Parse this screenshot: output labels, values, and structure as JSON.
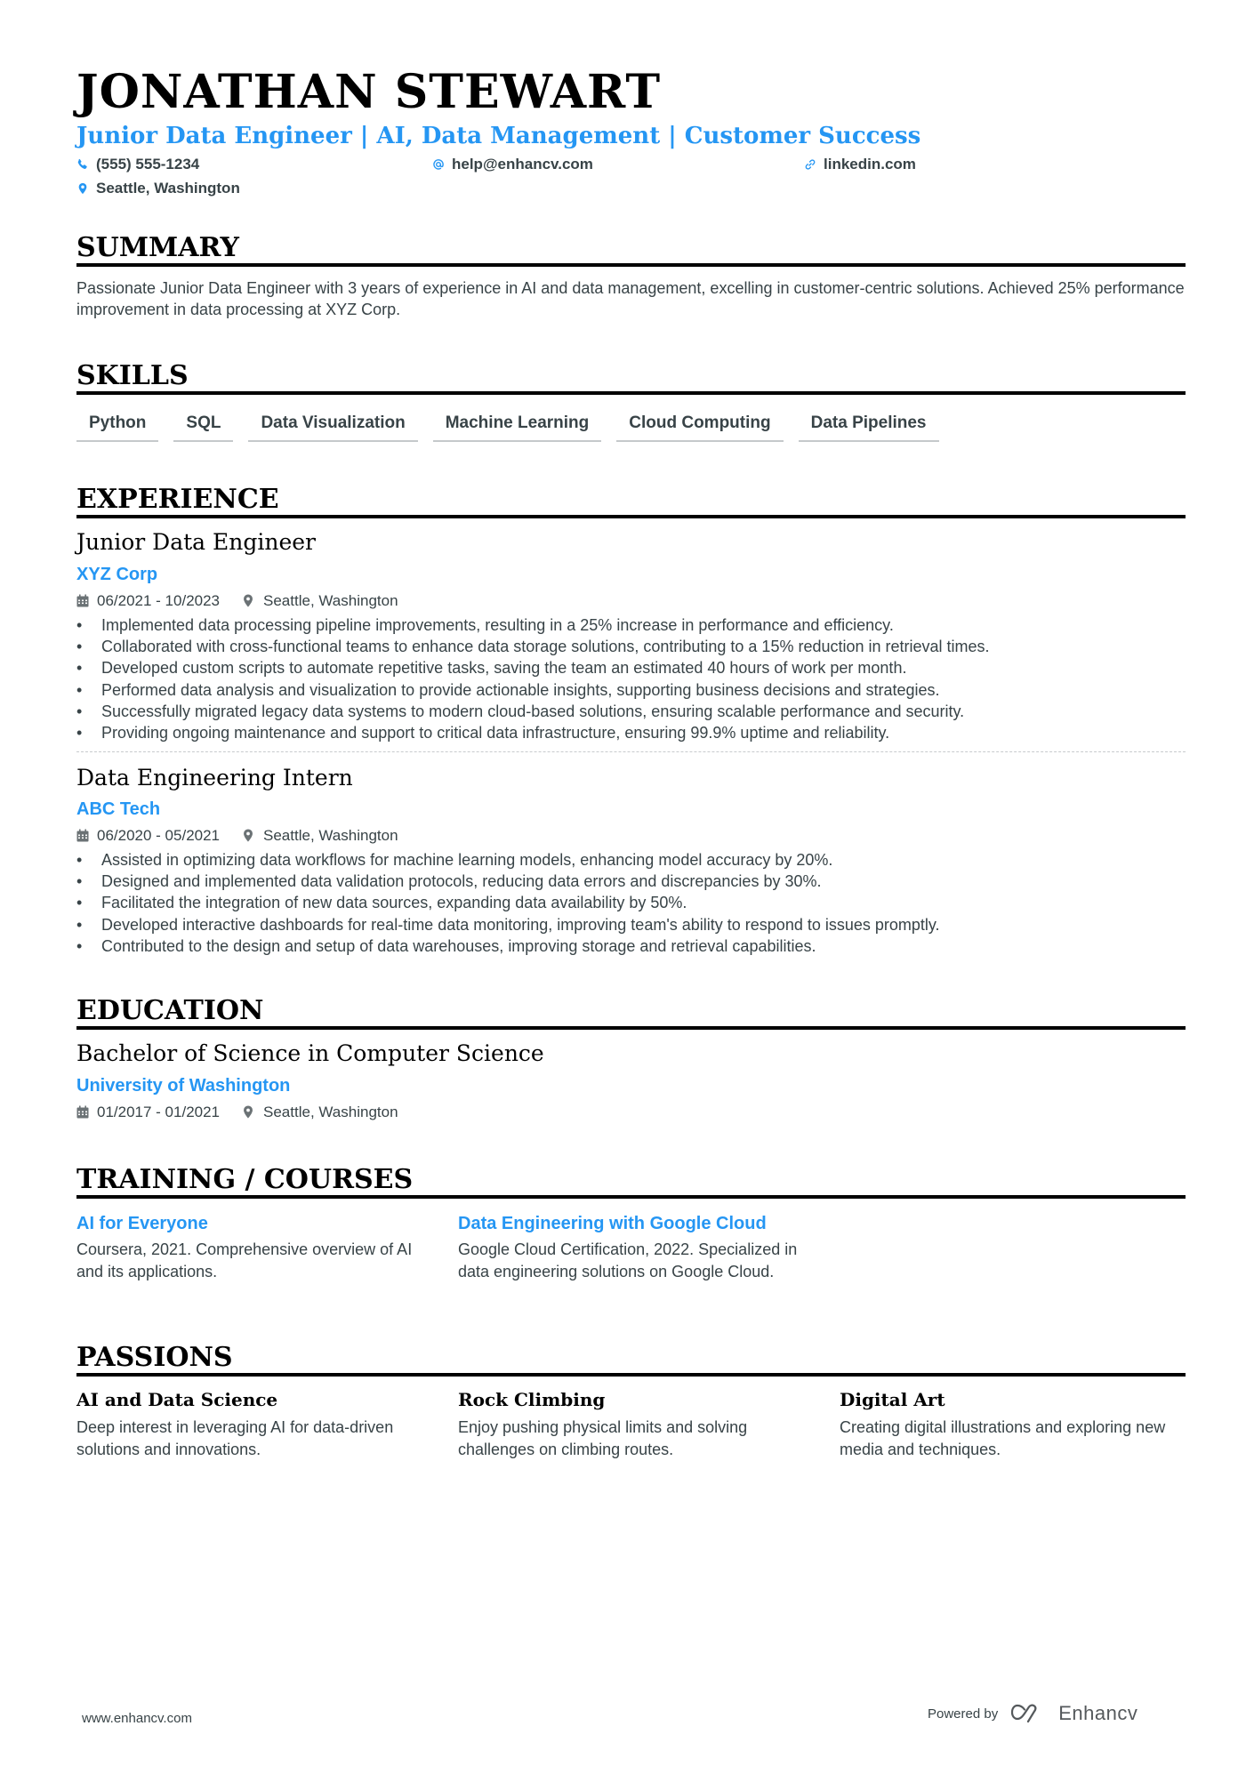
{
  "header": {
    "name": "JONATHAN STEWART",
    "headline": "Junior Data Engineer | AI, Data Management | Customer Success",
    "phone": "(555) 555-1234",
    "email": "help@enhancv.com",
    "website": "linkedin.com",
    "location": "Seattle, Washington",
    "accent_color": "#2596f3"
  },
  "summary": {
    "title": "SUMMARY",
    "text": "Passionate Junior Data Engineer with 3 years of experience in AI and data management, excelling in customer-centric solutions. Achieved 25% performance improvement in data processing at XYZ Corp."
  },
  "skills": {
    "title": "SKILLS",
    "items": [
      "Python",
      "SQL",
      "Data Visualization",
      "Machine Learning",
      "Cloud Computing",
      "Data Pipelines"
    ]
  },
  "experience": {
    "title": "EXPERIENCE",
    "items": [
      {
        "role": "Junior Data Engineer",
        "company": "XYZ Corp",
        "dates": "06/2021 - 10/2023",
        "location": "Seattle, Washington",
        "bullets": [
          "Implemented data processing pipeline improvements, resulting in a 25% increase in performance and efficiency.",
          "Collaborated with cross-functional teams to enhance data storage solutions, contributing to a 15% reduction in retrieval times.",
          "Developed custom scripts to automate repetitive tasks, saving the team an estimated 40 hours of work per month.",
          "Performed data analysis and visualization to provide actionable insights, supporting business decisions and strategies.",
          "Successfully migrated legacy data systems to modern cloud-based solutions, ensuring scalable performance and security.",
          "Providing ongoing maintenance and support to critical data infrastructure, ensuring 99.9% uptime and reliability."
        ]
      },
      {
        "role": "Data Engineering Intern",
        "company": "ABC Tech",
        "dates": "06/2020 - 05/2021",
        "location": "Seattle, Washington",
        "bullets": [
          "Assisted in optimizing data workflows for machine learning models, enhancing model accuracy by 20%.",
          "Designed and implemented data validation protocols, reducing data errors and discrepancies by 30%.",
          "Facilitated the integration of new data sources, expanding data availability by 50%.",
          "Developed interactive dashboards for real-time data monitoring, improving team's ability to respond to issues promptly.",
          "Contributed to the design and setup of data warehouses, improving storage and retrieval capabilities."
        ]
      }
    ]
  },
  "education": {
    "title": "EDUCATION",
    "degree": "Bachelor of Science in Computer Science",
    "school": "University of Washington",
    "dates": "01/2017 - 01/2021",
    "location": "Seattle, Washington"
  },
  "training": {
    "title": "TRAINING / COURSES",
    "items": [
      {
        "title": "AI for Everyone",
        "description": "Coursera, 2021. Comprehensive overview of AI and its applications."
      },
      {
        "title": "Data Engineering with Google Cloud",
        "description": "Google Cloud Certification, 2022. Specialized in data engineering solutions on Google Cloud."
      }
    ]
  },
  "passions": {
    "title": "PASSIONS",
    "items": [
      {
        "title": "AI and Data Science",
        "description": "Deep interest in leveraging AI for data-driven solutions and innovations."
      },
      {
        "title": "Rock Climbing",
        "description": "Enjoy pushing physical limits and solving challenges on climbing routes."
      },
      {
        "title": "Digital Art",
        "description": "Creating digital illustrations and exploring new media and techniques."
      }
    ]
  },
  "footer": {
    "website": "www.enhancv.com",
    "powered_by": "Powered by",
    "brand": "Enhancv"
  }
}
